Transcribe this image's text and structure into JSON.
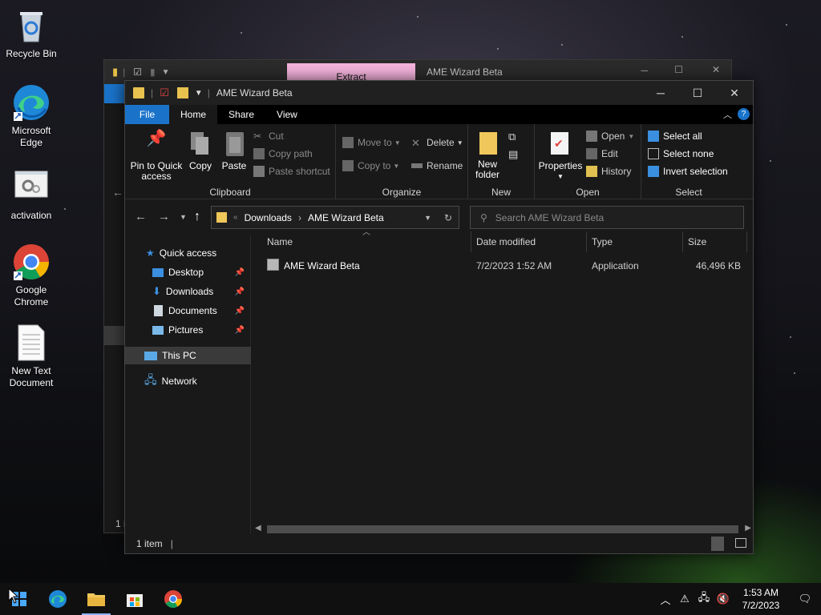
{
  "desktop": {
    "icons": [
      {
        "label": "Recycle Bin"
      },
      {
        "label": "Microsoft Edge"
      },
      {
        "label": "activation"
      },
      {
        "label": "Google Chrome"
      },
      {
        "label": "New Text Document"
      }
    ]
  },
  "back_window": {
    "title": "AME Wizard Beta",
    "contextual_tab": "Extract",
    "status": "1 i"
  },
  "window": {
    "title": "AME Wizard Beta",
    "ribbon_tabs": [
      "File",
      "Home",
      "Share",
      "View"
    ],
    "ribbon": {
      "clipboard": {
        "label": "Clipboard",
        "pin_label_1": "Pin to Quick",
        "pin_label_2": "access",
        "copy": "Copy",
        "paste": "Paste",
        "cut": "Cut",
        "copy_path": "Copy path",
        "paste_shortcut": "Paste shortcut"
      },
      "organize": {
        "label": "Organize",
        "move_to": "Move to",
        "copy_to": "Copy to",
        "delete": "Delete",
        "rename": "Rename"
      },
      "new": {
        "label": "New",
        "new_folder_1": "New",
        "new_folder_2": "folder"
      },
      "open": {
        "label": "Open",
        "properties": "Properties",
        "open": "Open",
        "edit": "Edit",
        "history": "History"
      },
      "select": {
        "label": "Select",
        "select_all": "Select all",
        "select_none": "Select none",
        "invert_selection": "Invert selection"
      }
    },
    "address": {
      "crumbs": [
        "Downloads",
        "AME Wizard Beta"
      ],
      "search_placeholder": "Search AME Wizard Beta"
    },
    "nav_pane": {
      "quick_access": "Quick access",
      "items": [
        {
          "label": "Desktop",
          "pinned": true
        },
        {
          "label": "Downloads",
          "pinned": true
        },
        {
          "label": "Documents",
          "pinned": true
        },
        {
          "label": "Pictures",
          "pinned": true
        }
      ],
      "this_pc": "This PC",
      "network": "Network"
    },
    "columns": [
      "Name",
      "Date modified",
      "Type",
      "Size"
    ],
    "files": [
      {
        "name": "AME Wizard Beta",
        "date": "7/2/2023 1:52 AM",
        "type": "Application",
        "size": "46,496 KB"
      }
    ],
    "status": "1 item"
  },
  "taskbar": {
    "time": "1:53 AM",
    "date": "7/2/2023"
  },
  "colors": {
    "file_tab": "#1a73c9",
    "extract_tab": "#f4b3dc",
    "window_bg": "#191919"
  }
}
